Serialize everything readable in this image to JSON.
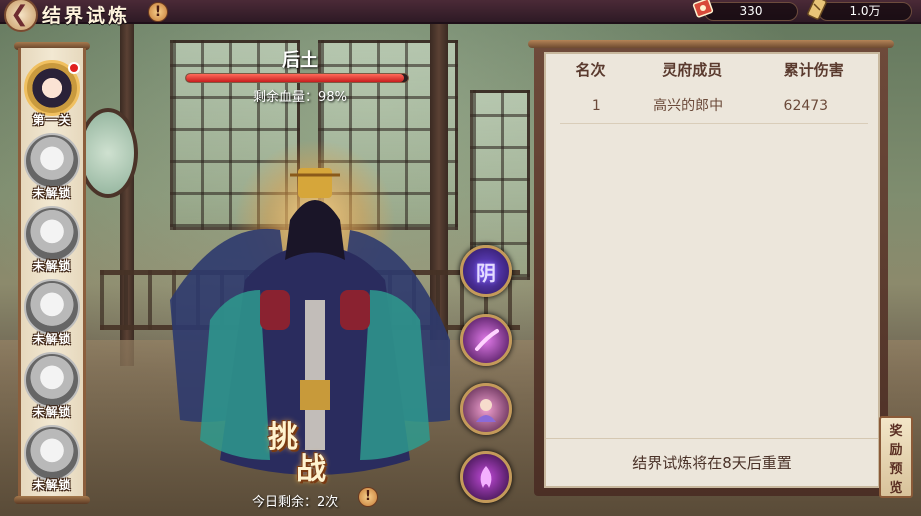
{
  "header": {
    "title": "结界试炼",
    "back_icon": "back-arrow-icon",
    "info_icon": "info-icon"
  },
  "resources": [
    {
      "icon": "ticket-icon",
      "value": "330"
    },
    {
      "icon": "scroll-icon",
      "value": "1.0万"
    }
  ],
  "portraits": [
    {
      "caption": "第一关",
      "state": "active",
      "has_notification": true
    },
    {
      "caption": "未解锁",
      "state": "locked"
    },
    {
      "caption": "未解锁",
      "state": "locked"
    },
    {
      "caption": "未解锁",
      "state": "locked"
    },
    {
      "caption": "未解锁",
      "state": "locked"
    },
    {
      "caption": "未解锁",
      "state": "locked"
    }
  ],
  "boss": {
    "name": "后土",
    "hp_label": "剩余血量：98%",
    "hp_fraction": 0.98
  },
  "skills": [
    {
      "icon": "yin-skill-icon",
      "text": "阴"
    },
    {
      "icon": "slash-skill-icon"
    },
    {
      "icon": "summon-skill-icon"
    },
    {
      "icon": "flame-skill-icon"
    }
  ],
  "challenge": {
    "label_1": "挑",
    "label_2": "战",
    "remaining": "今日剩余：2次"
  },
  "ranking": {
    "headers": [
      "名次",
      "灵府成员",
      "累计伤害"
    ],
    "rows": [
      {
        "rank": "1",
        "member": "高兴的郎中",
        "damage": "62473"
      }
    ],
    "footer": "结界试炼将在8天后重置"
  },
  "reward_button": {
    "line1": "奖励",
    "line2": "预览"
  },
  "colors": {
    "accent_gold": "#c49a5a",
    "hp_red": "#c81e1e",
    "panel_bg": "#ece6db",
    "topbar": "#3a2030"
  }
}
